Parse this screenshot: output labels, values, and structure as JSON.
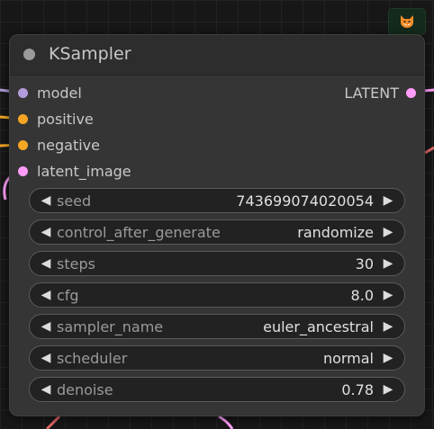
{
  "badge": {
    "icon": "fox-icon"
  },
  "node": {
    "title": "KSampler",
    "inputs": [
      {
        "label": "model",
        "color": "#b39ddb"
      },
      {
        "label": "positive",
        "color": "#f5a623"
      },
      {
        "label": "negative",
        "color": "#f5a623"
      },
      {
        "label": "latent_image",
        "color": "#ff9cf9"
      }
    ],
    "output": {
      "label": "LATENT",
      "color": "#ff9cf9"
    },
    "widgets": [
      {
        "label": "seed",
        "value": "743699074020054"
      },
      {
        "label": "control_after_generate",
        "value": "randomize"
      },
      {
        "label": "steps",
        "value": "30"
      },
      {
        "label": "cfg",
        "value": "8.0"
      },
      {
        "label": "sampler_name",
        "value": "euler_ancestral"
      },
      {
        "label": "scheduler",
        "value": "normal"
      },
      {
        "label": "denoise",
        "value": "0.78"
      }
    ],
    "arrow_left": "◀",
    "arrow_right": "▶"
  }
}
